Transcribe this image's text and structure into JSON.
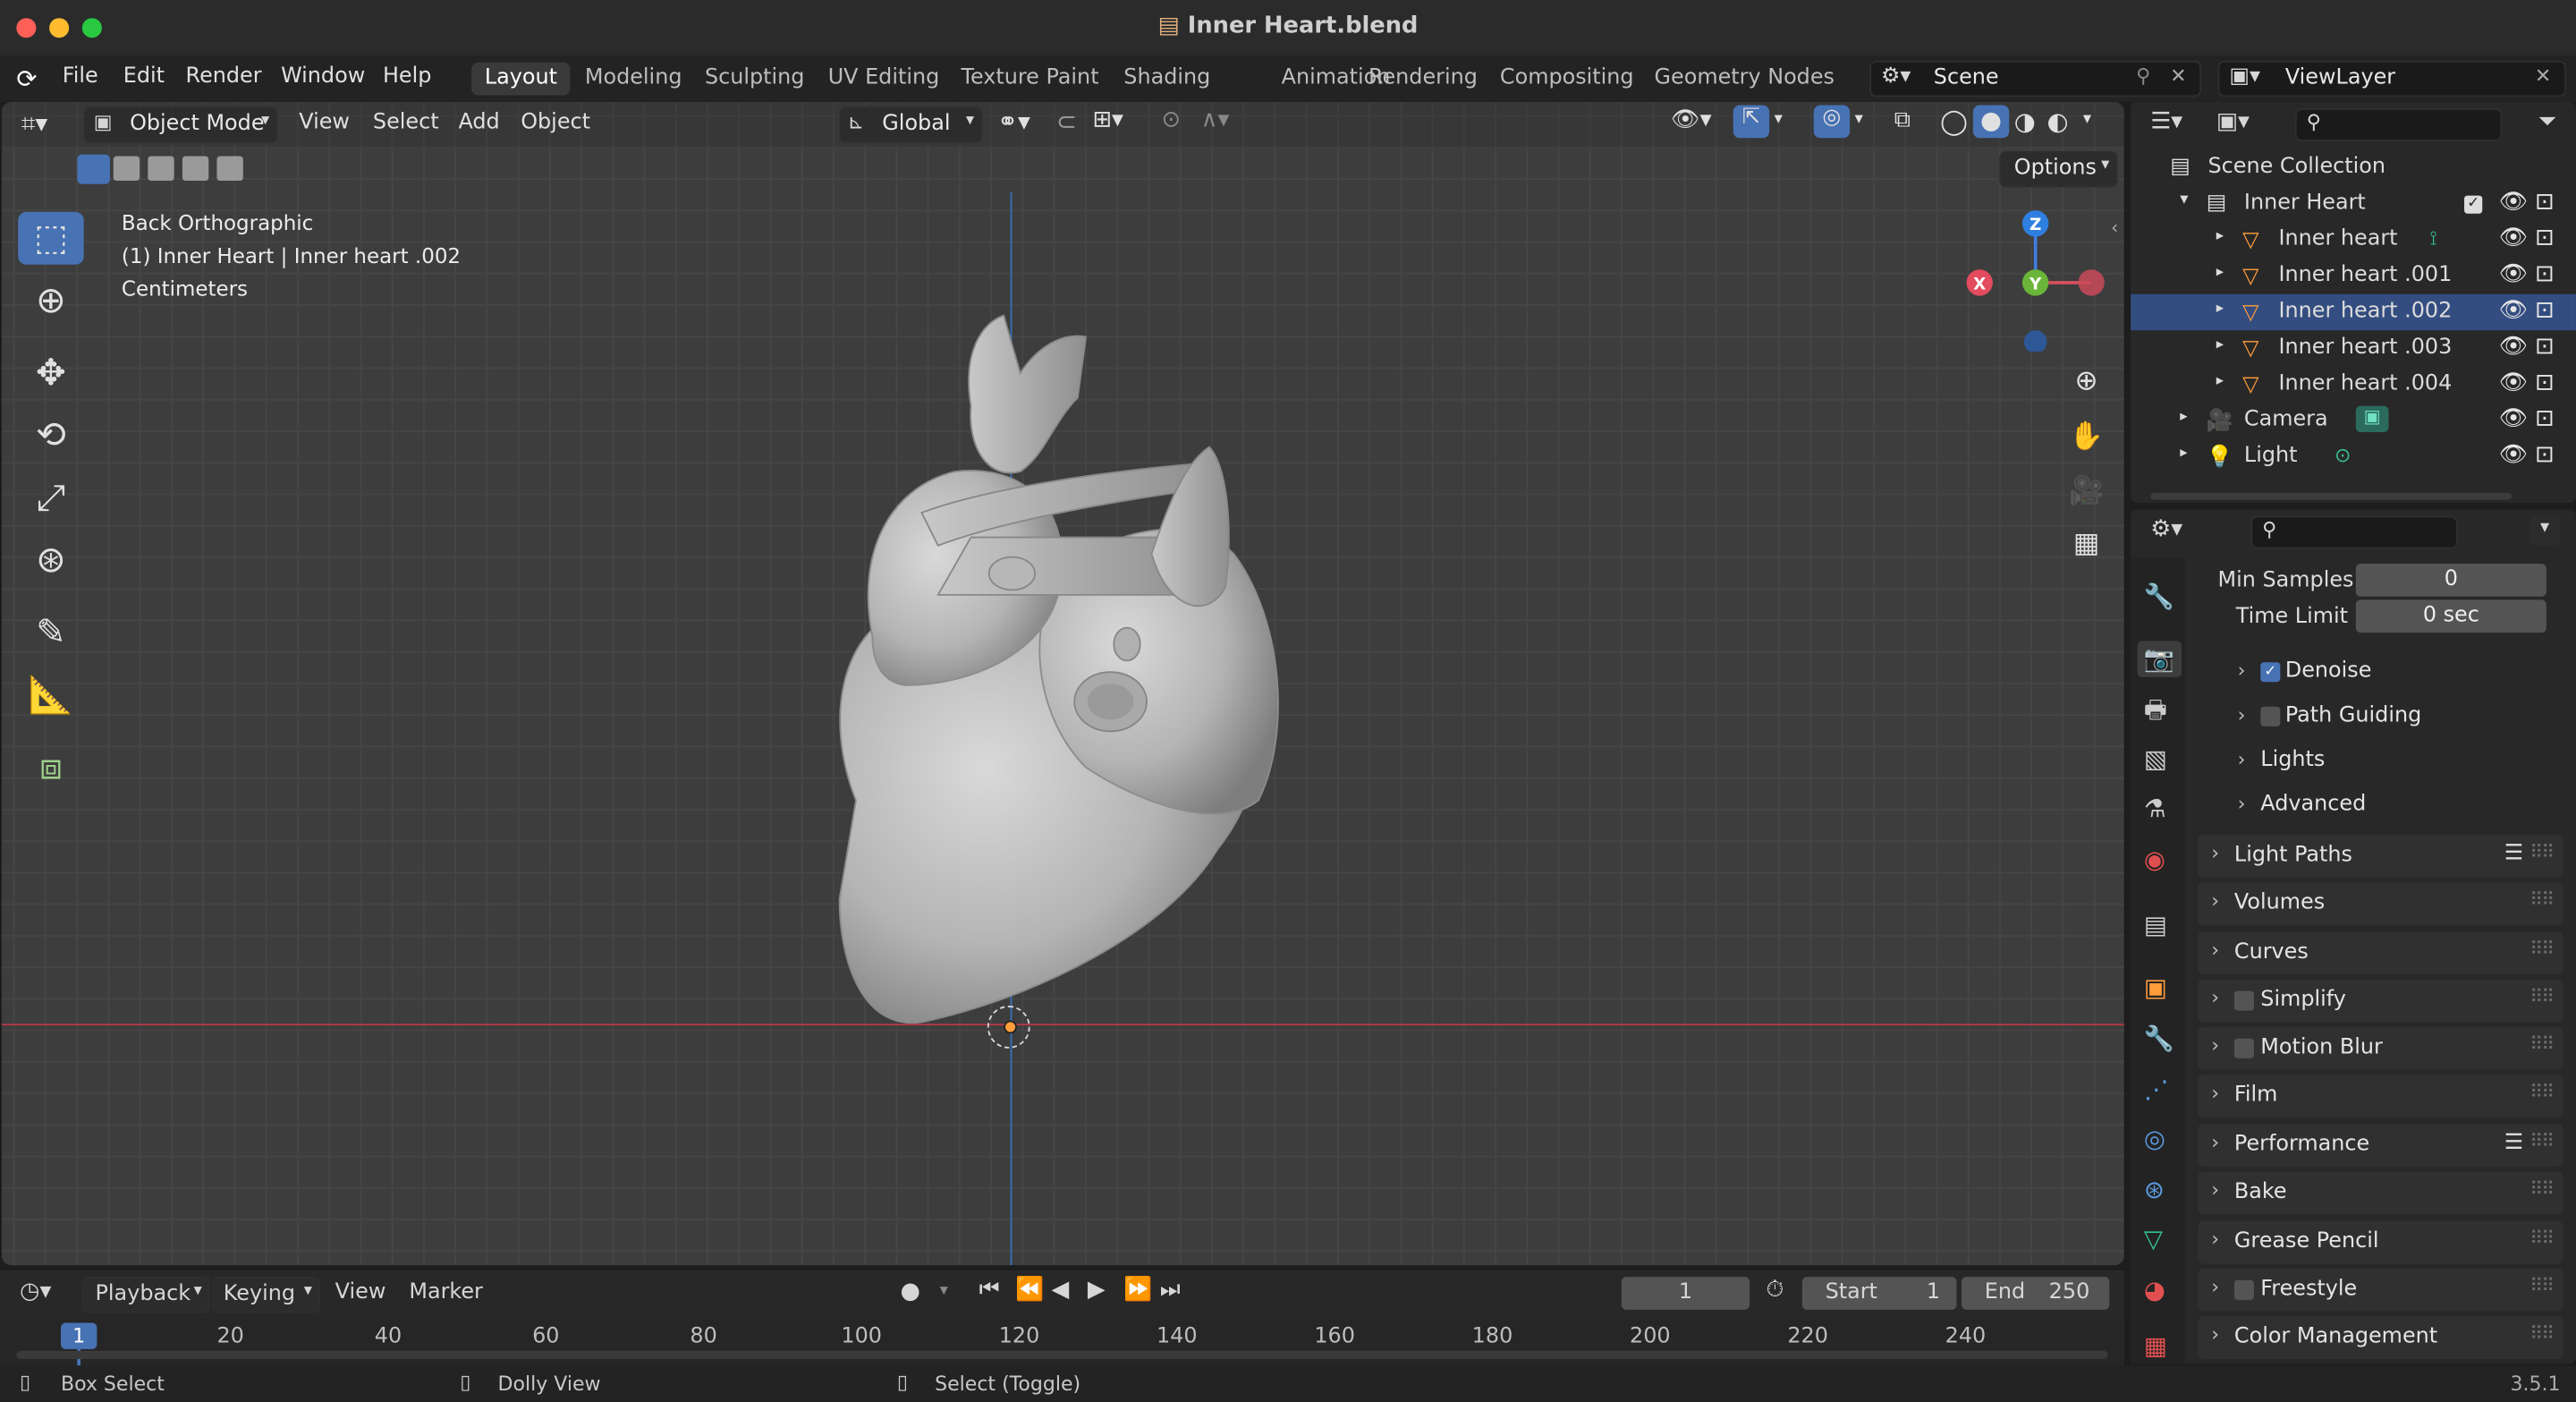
{
  "window": {
    "title": "Inner Heart.blend"
  },
  "menu": {
    "file": "File",
    "edit": "Edit",
    "render": "Render",
    "window": "Window",
    "help": "Help"
  },
  "workspaces": [
    "Layout",
    "Modeling",
    "Sculpting",
    "UV Editing",
    "Texture Paint",
    "Shading",
    "Animation",
    "Rendering",
    "Compositing",
    "Geometry Nodes"
  ],
  "scene": {
    "name": "Scene",
    "view_layer": "ViewLayer"
  },
  "viewport": {
    "mode": "Object Mode",
    "menus": {
      "view": "View",
      "select": "Select",
      "add": "Add",
      "object": "Object"
    },
    "transform_orientation": "Global",
    "options_label": "Options",
    "overlay_info": {
      "line1": "Back Orthographic",
      "line2": "(1) Inner Heart | Inner heart .002",
      "line3": "Centimeters"
    },
    "gizmo": {
      "z": "Z",
      "y": "Y",
      "x": "X"
    }
  },
  "outliner": {
    "root": "Scene Collection",
    "collection": "Inner Heart",
    "objects": [
      {
        "name": "Inner heart",
        "selected": false
      },
      {
        "name": "Inner heart .001",
        "selected": false
      },
      {
        "name": "Inner heart .002",
        "selected": true
      },
      {
        "name": "Inner heart .003",
        "selected": false
      },
      {
        "name": "Inner heart .004",
        "selected": false
      }
    ],
    "camera": "Camera",
    "light": "Light"
  },
  "properties": {
    "min_samples": {
      "label": "Min Samples",
      "value": "0"
    },
    "time_limit": {
      "label": "Time Limit",
      "value": "0 sec"
    },
    "sub_panels": [
      {
        "label": "Denoise",
        "checkbox": true,
        "checked": true
      },
      {
        "label": "Path Guiding",
        "checkbox": true,
        "checked": false
      },
      {
        "label": "Lights",
        "checkbox": false
      },
      {
        "label": "Advanced",
        "checkbox": false
      }
    ],
    "panels": [
      {
        "label": "Light Paths",
        "checkbox": false,
        "presets": true
      },
      {
        "label": "Volumes",
        "checkbox": false
      },
      {
        "label": "Curves",
        "checkbox": false
      },
      {
        "label": "Simplify",
        "checkbox": true,
        "checked": false
      },
      {
        "label": "Motion Blur",
        "checkbox": true,
        "checked": false
      },
      {
        "label": "Film",
        "checkbox": false
      },
      {
        "label": "Performance",
        "checkbox": false,
        "presets": true
      },
      {
        "label": "Bake",
        "checkbox": false
      },
      {
        "label": "Grease Pencil",
        "checkbox": false
      },
      {
        "label": "Freestyle",
        "checkbox": true,
        "checked": false
      },
      {
        "label": "Color Management",
        "checkbox": false
      }
    ]
  },
  "timeline": {
    "menus": {
      "playback": "Playback",
      "keying": "Keying",
      "view": "View",
      "marker": "Marker"
    },
    "current_frame": "1",
    "start_label": "Start",
    "start": "1",
    "end_label": "End",
    "end": "250",
    "ruler": [
      "20",
      "40",
      "60",
      "80",
      "100",
      "120",
      "140",
      "160",
      "180",
      "200",
      "220",
      "240"
    ],
    "playhead": "1"
  },
  "statusbar": {
    "left": "Box Select",
    "middle": "Dolly View",
    "right": "Select (Toggle)",
    "version": "3.5.1"
  }
}
